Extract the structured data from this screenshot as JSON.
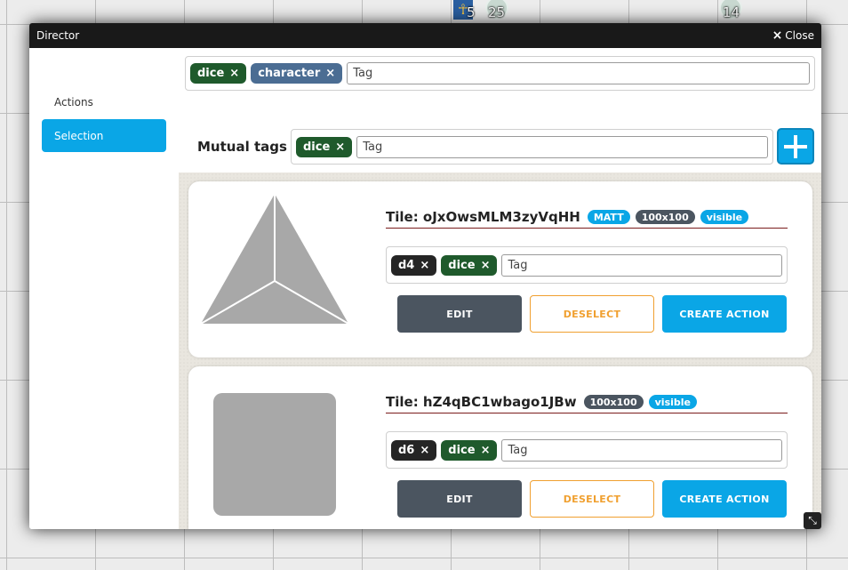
{
  "canvas": {
    "token_a_number": "5",
    "token_b_number": "25",
    "token_c_number": "14",
    "skull_glyph": "💀",
    "ankh_glyph": "☥"
  },
  "window": {
    "title": "Director",
    "close_label": "Close",
    "close_glyph": "×"
  },
  "sidebar": {
    "items": [
      {
        "label": "Actions"
      },
      {
        "label": "Selection"
      }
    ]
  },
  "search": {
    "tags": [
      {
        "label": "dice",
        "color": "#1f5a2c"
      },
      {
        "label": "character",
        "color": "#4b6d93"
      }
    ],
    "placeholder": "Tag"
  },
  "mutual": {
    "label": "Mutual tags",
    "tags": [
      {
        "label": "dice",
        "color": "#1f5a2c"
      }
    ],
    "placeholder": "Tag"
  },
  "remove_glyph": "×",
  "tiles": [
    {
      "title": "Tile: oJxOwsMLM3zyVqHH",
      "badges": [
        "MATT",
        "100x100",
        "visible"
      ],
      "tags": [
        "d4",
        "dice"
      ],
      "placeholder": "Tag",
      "shape": "d4-triangle-icon"
    },
    {
      "title": "Tile: hZ4qBC1wbago1JBw",
      "badges": [
        "100x100",
        "visible"
      ],
      "tags": [
        "d6",
        "dice"
      ],
      "placeholder": "Tag",
      "shape": "d6-square-icon"
    }
  ],
  "buttons": {
    "edit": "EDIT",
    "deselect": "DESELECT",
    "create_action": "CREATE ACTION"
  },
  "colors": {
    "accent": "#0aa6e6",
    "tag_green": "#1f5a2c",
    "tag_blue": "#4b6d93",
    "tag_dark": "#252525",
    "badge_gray": "#4b5560",
    "deselect_orange": "#f0a030"
  }
}
